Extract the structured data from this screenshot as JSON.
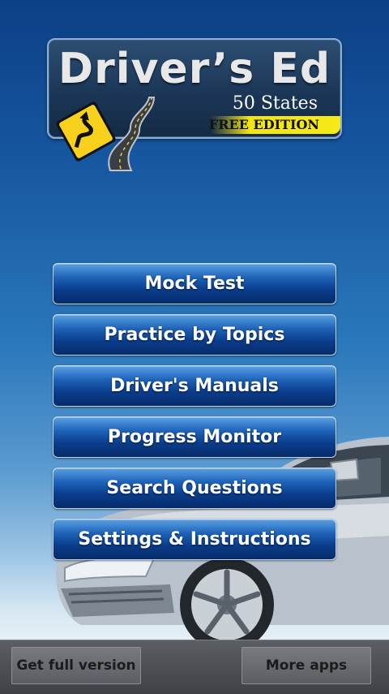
{
  "logo": {
    "title": "Driver’s Ed",
    "subtitle": "50 States",
    "edition": "FREE EDITION",
    "colors": {
      "band": "#f2e514",
      "sign": "#f7d11c"
    }
  },
  "menu": {
    "items": [
      {
        "label": "Mock Test"
      },
      {
        "label": "Practice by Topics"
      },
      {
        "label": "Driver's Manuals"
      },
      {
        "label": "Progress Monitor"
      },
      {
        "label": "Search Questions"
      },
      {
        "label": "Settings & Instructions"
      }
    ]
  },
  "bottom_bar": {
    "full_version_label": "Get full version",
    "more_apps_label": "More apps"
  },
  "icons": {
    "sign": "winding-road-sign-icon",
    "road": "road-icon",
    "car": "car-image"
  },
  "colors": {
    "background_top": "#0d3f86",
    "button_dark": "#0b3d8c",
    "button_light": "#5aa0e2"
  }
}
